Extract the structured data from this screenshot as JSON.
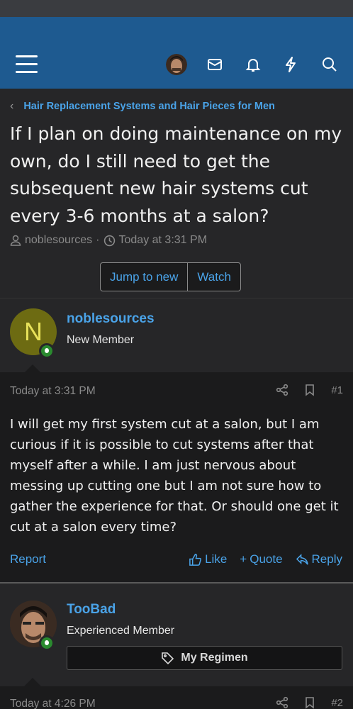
{
  "header": {
    "icons": [
      "menu-icon",
      "avatar",
      "mail-icon",
      "bell-icon",
      "bolt-icon",
      "search-icon"
    ]
  },
  "breadcrumb": {
    "label": "Hair Replacement Systems and Hair Pieces for Men"
  },
  "thread": {
    "title": "If I plan on doing maintenance on my own, do I still need to get the subsequent new hair systems cut every 3-6 months at a salon?",
    "author": "noblesources",
    "separator": "·",
    "time": "Today at 3:31 PM",
    "jump_label": "Jump to new",
    "watch_label": "Watch"
  },
  "posts": [
    {
      "username": "noblesources",
      "avatar_letter": "N",
      "user_title": "New Member",
      "date": "Today at 3:31 PM",
      "number": "#1",
      "body": "I will get my first system cut at a salon, but I am curious if it is possible to cut systems after that myself after a while. I am just nervous about messing up cutting one but I am not sure how to gather the experience for that. Or should one get it cut at a salon every time?",
      "report_label": "Report",
      "like_label": "Like",
      "quote_label": "Quote",
      "reply_label": "Reply"
    },
    {
      "username": "TooBad",
      "user_title": "Experienced Member",
      "regimen_label": "My Regimen",
      "date": "Today at 4:26 PM",
      "number": "#2"
    }
  ],
  "colors": {
    "accent": "#4aa3e8",
    "header": "#1e5a90",
    "online": "#2a8a2f"
  }
}
